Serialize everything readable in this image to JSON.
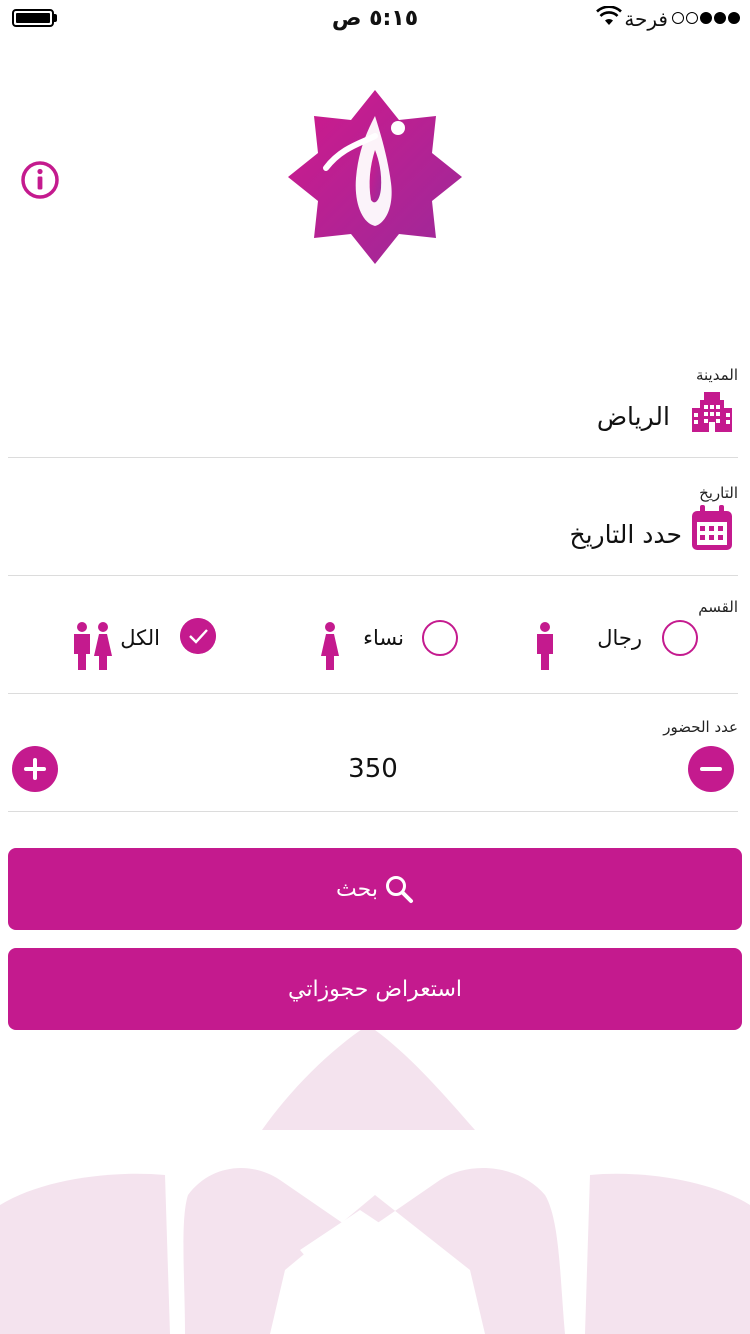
{
  "status_bar": {
    "time": "٥:١٥ ص",
    "carrier": "فرحة"
  },
  "form": {
    "city": {
      "label": "المدينة",
      "value": "الرياض"
    },
    "date": {
      "label": "التاريخ",
      "value": "حدد التاريخ"
    },
    "section": {
      "label": "القسم",
      "options": [
        {
          "label": "رجال",
          "selected": false
        },
        {
          "label": "نساء",
          "selected": false
        },
        {
          "label": "الكل",
          "selected": true
        }
      ]
    },
    "attendees": {
      "label": "عدد الحضور",
      "value": "350"
    }
  },
  "buttons": {
    "search_label": "بحث",
    "my_bookings_label": "استعراض حجوزاتي"
  },
  "colors": {
    "accent": "#c41a8e",
    "logo_end": "#9b2a9a"
  },
  "icons": [
    "wifi-icon",
    "info-icon",
    "city-icon",
    "calendar-icon",
    "man-icon",
    "woman-icon",
    "couple-icon",
    "check-icon",
    "minus-icon",
    "plus-icon",
    "search-icon"
  ]
}
